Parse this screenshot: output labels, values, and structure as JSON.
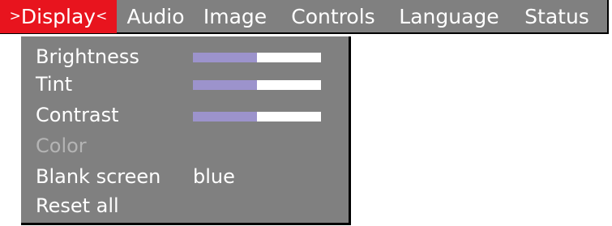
{
  "menubar": {
    "tabs": [
      {
        "label": "Display",
        "active": true,
        "left_marker": ">",
        "right_marker": "<"
      },
      {
        "label": "Audio",
        "active": false
      },
      {
        "label": "Image",
        "active": false
      },
      {
        "label": "Controls",
        "active": false
      },
      {
        "label": "Language",
        "active": false
      },
      {
        "label": "Status",
        "active": false
      }
    ]
  },
  "display_menu": {
    "items": [
      {
        "label": "Brightness",
        "type": "slider",
        "value": 0.5
      },
      {
        "label": "Tint",
        "type": "slider",
        "value": 0.5
      },
      {
        "label": "Contrast",
        "type": "slider",
        "value": 0.5
      },
      {
        "label": "Color",
        "type": "disabled"
      },
      {
        "label": "Blank screen",
        "type": "value",
        "value": "blue"
      },
      {
        "label": "Reset all",
        "type": "action"
      }
    ]
  },
  "colors": {
    "menu_gray": "#808080",
    "active_tab_red": "#e8141e",
    "slider_fill": "#9c93cc",
    "disabled_text": "#b4b4b4"
  }
}
